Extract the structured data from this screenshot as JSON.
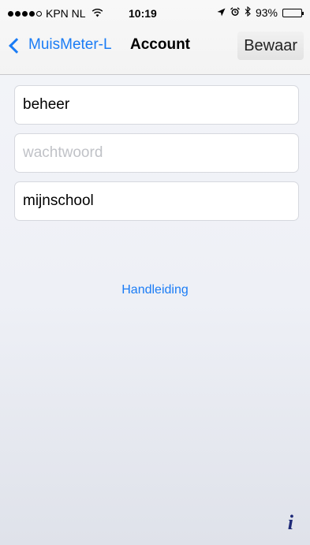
{
  "status_bar": {
    "carrier": "KPN NL",
    "time": "10:19",
    "battery": "93%",
    "battery_level": 0.93,
    "signal_icon": "signal-dots-icon",
    "wifi_icon": "wifi-icon",
    "location_icon": "location-arrow-icon",
    "alarm_icon": "alarm-clock-icon",
    "bluetooth_icon": "bluetooth-icon"
  },
  "nav": {
    "back_label": "MuisMeter-L",
    "title": "Account",
    "save_label": "Bewaar"
  },
  "form": {
    "username_value": "beheer",
    "password_placeholder": "wachtwoord",
    "school_value": "mijnschool"
  },
  "links": {
    "manual": "Handleiding"
  },
  "footer": {
    "info_icon": "info-icon"
  },
  "colors": {
    "accent": "#1a7cf5",
    "info": "#1e2a78"
  }
}
